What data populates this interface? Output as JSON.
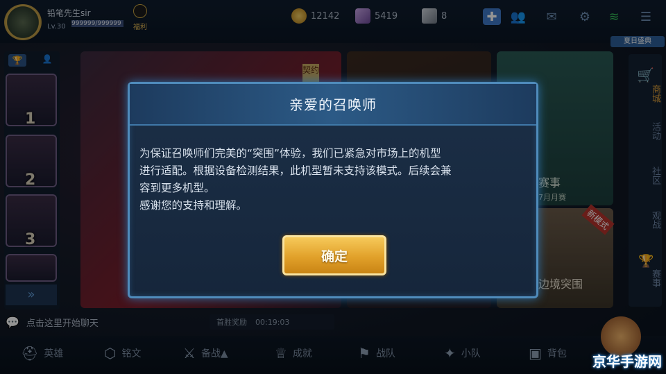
{
  "player": {
    "name": "铅笔先生sir",
    "level": "Lv.30",
    "exp": "999999/999999",
    "bonus": "福利"
  },
  "currency": {
    "gold": "12142",
    "diamond": "5419",
    "voucher": "8"
  },
  "topbar_icons": [
    "plus-icon",
    "friends-icon",
    "mail-icon",
    "gear-icon",
    "wifi-icon",
    "menu-icon"
  ],
  "daily_badge": "夏日盛典",
  "right_menu": {
    "shop": "商城",
    "activity": "活动",
    "community": "社区",
    "watch": "观战",
    "match": "赛事"
  },
  "center_cards": {
    "contract": "契约",
    "event_title": "赛事",
    "event_sub": "7月月赛",
    "new_mode": "新模式",
    "breakout": "边境突围"
  },
  "chat": {
    "hint": "点击这里开始聊天"
  },
  "first_win": {
    "label": "首胜奖励",
    "time": "00:19:03"
  },
  "bottom_nav": [
    {
      "label": "英雄",
      "icon": "helmet-icon"
    },
    {
      "label": "铭文",
      "icon": "rune-icon"
    },
    {
      "label": "备战▲",
      "icon": "weapon-icon"
    },
    {
      "label": "成就",
      "icon": "trophy-icon"
    },
    {
      "label": "战队",
      "icon": "team-icon"
    },
    {
      "label": "小队",
      "icon": "wolf-icon"
    },
    {
      "label": "背包",
      "icon": "bag-icon"
    }
  ],
  "dialog": {
    "title": "亲爱的召唤师",
    "lines": [
      "为保证召唤师们完美的“突围”体验，我们已紧急对市场上的机型",
      "进行适配。根据设备检测结果，此机型暂未支持该模式。后续会兼",
      "容到更多机型。",
      "感谢您的支持和理解。"
    ],
    "confirm": "确定"
  },
  "watermark": "京华手游网",
  "colors": {
    "dialog_border": "#4f8bbb",
    "confirm_button": "#e1a12a",
    "background": "#0b1522"
  }
}
